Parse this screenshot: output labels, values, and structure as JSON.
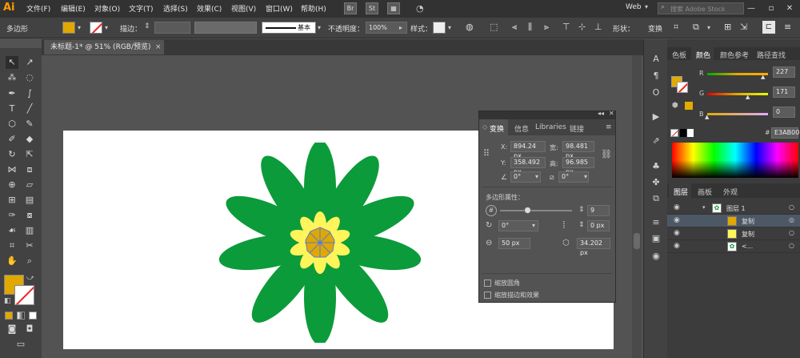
{
  "app": {
    "logo": "Ai"
  },
  "menu": [
    "文件(F)",
    "编辑(E)",
    "对象(O)",
    "文字(T)",
    "选择(S)",
    "效果(C)",
    "视图(V)",
    "窗口(W)",
    "帮助(H)"
  ],
  "menubar": {
    "br_label": "Br",
    "st_label": "St",
    "workspace": "Web",
    "search_placeholder": "搜索 Adobe Stock"
  },
  "control": {
    "object_type": "多边形",
    "stroke_label": "描边：",
    "stroke_style": "基本",
    "opacity_label": "不透明度：",
    "opacity_value": "100%",
    "style_label": "样式：",
    "shape_label": "形状：",
    "transform_label": "变换",
    "fill_color": "#e0a800"
  },
  "document": {
    "tab_title": "未标题-1* @ 51% (RGB/预览)"
  },
  "transform_panel": {
    "tabs": [
      "变换",
      "信息",
      "Libraries",
      "链接"
    ],
    "x_label": "X:",
    "x_value": "894.24 px",
    "y_label": "Y:",
    "y_value": "358.492 px",
    "w_label": "宽:",
    "w_value": "98.481 px",
    "h_label": "高:",
    "h_value": "96.985 px",
    "rotate_value": "0°",
    "shear_value": "0°",
    "polygon_props_label": "多边形属性：",
    "sides_value": "9",
    "poly_rotate_value": "0°",
    "corner_value": "0 px",
    "radius_value": "50 px",
    "side_length_value": "34.202 px",
    "scale_corners_label": "缩放圆角",
    "scale_strokes_label": "缩放描边和效果"
  },
  "color_panel": {
    "tabs": [
      "色板",
      "颜色",
      "颜色参考",
      "路径查找"
    ],
    "r_label": "R",
    "r_value": "227",
    "g_label": "G",
    "g_value": "171",
    "b_label": "B",
    "b_value": "0",
    "hex_value": "E3AB00"
  },
  "layers_panel": {
    "tabs": [
      "图层",
      "画板",
      "外观"
    ],
    "rows": [
      "图层 1",
      "复制",
      "复制",
      "<..."
    ]
  },
  "colors": {
    "petal_dark": "#0c9b3a",
    "petal_light": "#fff45a",
    "center": "#e0a800",
    "current_fill": "#e3ab00"
  }
}
